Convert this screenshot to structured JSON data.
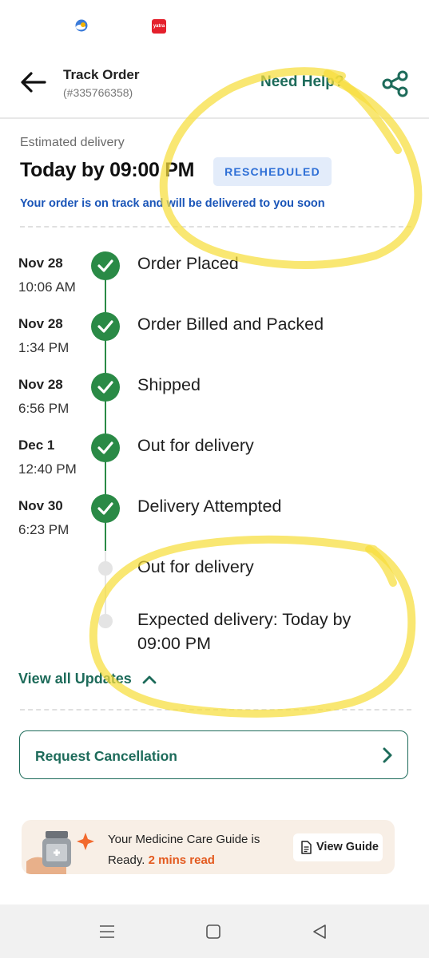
{
  "status_bar": {
    "weather_icon": "weather-cloud-icon",
    "app_icon_text": "yatra"
  },
  "header": {
    "title": "Track Order",
    "order_id": "(#335766358)",
    "help_label": "Need Help?",
    "back_icon": "back-arrow-icon",
    "share_icon": "share-icon"
  },
  "estimate": {
    "label": "Estimated delivery",
    "time": "Today by 09:00 PM",
    "badge": "RESCHEDULED",
    "message": "Your order is on track and will be delivered to you soon"
  },
  "timeline": [
    {
      "date": "Nov 28",
      "time": "10:06 AM",
      "status": "Order Placed",
      "done": true
    },
    {
      "date": "Nov 28",
      "time": "1:34 PM",
      "status": "Order Billed and Packed",
      "done": true
    },
    {
      "date": "Nov 28",
      "time": "6:56 PM",
      "status": "Shipped",
      "done": true
    },
    {
      "date": "Dec 1",
      "time": "12:40 PM",
      "status": "Out for delivery",
      "done": true
    },
    {
      "date": "Nov 30",
      "time": "6:23 PM",
      "status": "Delivery Attempted",
      "done": true
    },
    {
      "status": "Out for delivery",
      "done": false
    },
    {
      "status_line1": "Expected delivery: Today by",
      "status_line2": "09:00 PM",
      "done": false
    }
  ],
  "view_all": {
    "label": "View all Updates",
    "icon": "chevron-up-icon"
  },
  "cancel": {
    "label": "Request Cancellation",
    "icon": "chevron-right-icon"
  },
  "guide": {
    "line1": "Your Medicine Care Guide is",
    "line2_prefix": "Ready.",
    "read_time": "2 mins read",
    "button_label": "View Guide",
    "button_icon": "document-icon"
  },
  "colors": {
    "brand_green": "#1d6b5a",
    "check_green": "#2a8a46",
    "badge_blue": "#2e6fd6",
    "accent_orange": "#e35a1f",
    "highlighter": "#f7de3c"
  }
}
